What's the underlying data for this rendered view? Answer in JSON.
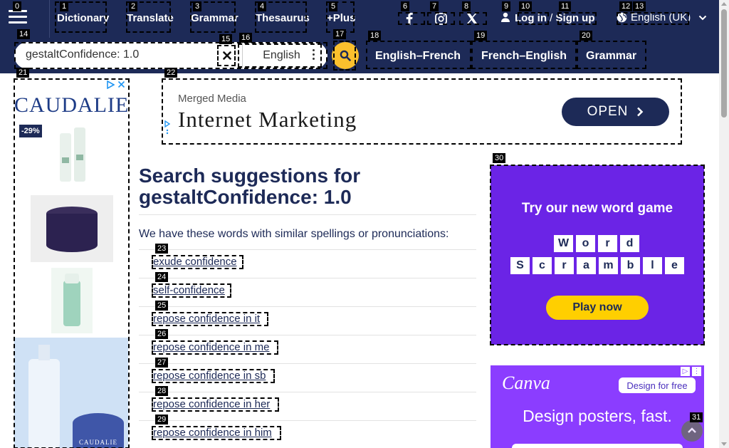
{
  "nav": {
    "menu_icon": "hamburger-icon",
    "links": [
      "Dictionary",
      "Translate",
      "Grammar",
      "Thesaurus",
      "+Plus"
    ],
    "social_icons": [
      "facebook-icon",
      "instagram-icon",
      "x-twitter-icon"
    ],
    "login": "Log in",
    "slash": "/",
    "signup": "Sign up",
    "language": "English (UK)"
  },
  "search": {
    "value": "gestaltConfidence: 1.0",
    "dictionary": "English",
    "subnav": [
      "English–French",
      "French–English",
      "Grammar"
    ]
  },
  "ads": {
    "left": {
      "brand": "CAUDALIE",
      "discount": "-29%"
    },
    "banner": {
      "advertiser": "Merged Media",
      "title": "Internet Marketing",
      "cta": "OPEN"
    },
    "game": {
      "title": "Try our new word game",
      "row1": [
        "W",
        "o",
        "r",
        "d"
      ],
      "row2": [
        "S",
        "c",
        "r",
        "a",
        "m",
        "b",
        "l",
        "e"
      ],
      "cta": "Play now"
    },
    "canva": {
      "logo": "Canva",
      "cta": "Design for free",
      "headline": "Design posters, fast."
    }
  },
  "results": {
    "heading": "Search suggestions for",
    "query": "gestaltConfidence: 1.0",
    "intro": "We have these words with similar spellings or pronunciations:",
    "suggestions": [
      "exude confidence",
      "self-confidence",
      "repose confidence in it",
      "repose confidence in me",
      "repose confidence in sb",
      "repose confidence in her",
      "repose confidence in him"
    ]
  },
  "overlay": {
    "numbers": [
      "0",
      "1",
      "2",
      "3",
      "4",
      "5",
      "6",
      "7",
      "8",
      "9",
      "10",
      "11",
      "12",
      "13",
      "14",
      "15",
      "16",
      "17",
      "18",
      "19",
      "20",
      "21",
      "22",
      "23",
      "24",
      "25",
      "26",
      "27",
      "28",
      "29",
      "30",
      "31"
    ]
  }
}
